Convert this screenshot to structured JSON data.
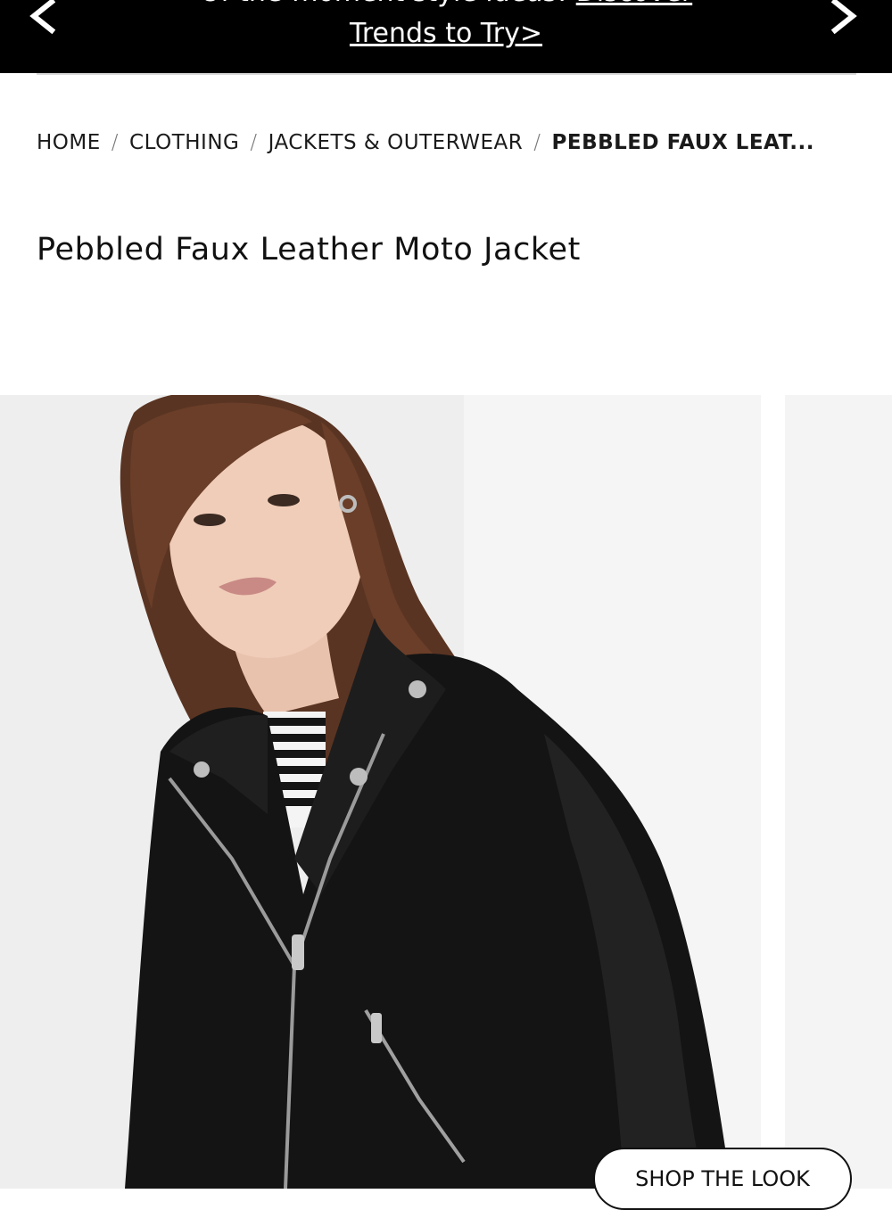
{
  "promo": {
    "text_line1": "Of-the-moment style ideas!",
    "link_line1": "Discover",
    "link_line2": "Trends to Try>"
  },
  "breadcrumb": {
    "items": [
      "HOME",
      "CLOTHING",
      "JACKETS & OUTERWEAR"
    ],
    "current": "PEBBLED FAUX LEAT...",
    "separator": "/"
  },
  "product": {
    "title": "Pebbled Faux Leather Moto Jacket"
  },
  "image": {
    "shop_the_look": "SHOP THE LOOK"
  }
}
